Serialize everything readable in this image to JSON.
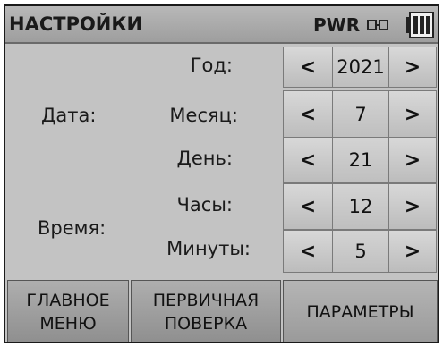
{
  "header": {
    "title": "НАСТРОЙКИ",
    "power_label": "PWR",
    "plug_icon": "plug-icon",
    "battery_icon": "battery-icon"
  },
  "groups": {
    "date_label": "Дата:",
    "time_label": "Время:"
  },
  "rows": [
    {
      "label": "Год:",
      "value": "2021",
      "dec": "<",
      "inc": ">"
    },
    {
      "label": "Месяц:",
      "value": "7",
      "dec": "<",
      "inc": ">"
    },
    {
      "label": "День:",
      "value": "21",
      "dec": "<",
      "inc": ">"
    },
    {
      "label": "Часы:",
      "value": "12",
      "dec": "<",
      "inc": ">"
    },
    {
      "label": "Минуты:",
      "value": "5",
      "dec": "<",
      "inc": ">"
    }
  ],
  "footer": {
    "main_menu_line1": "ГЛАВНОЕ",
    "main_menu_line2": "МЕНЮ",
    "initial_check_line1": "ПЕРВИЧНАЯ",
    "initial_check_line2": "ПОВЕРКА",
    "parameters": "ПАРАМЕТРЫ"
  },
  "colors": {
    "screen_bg": "#c3c3c3",
    "titlebar_bg": "#a8a8a8",
    "button_bg": "#cfcfcf"
  }
}
